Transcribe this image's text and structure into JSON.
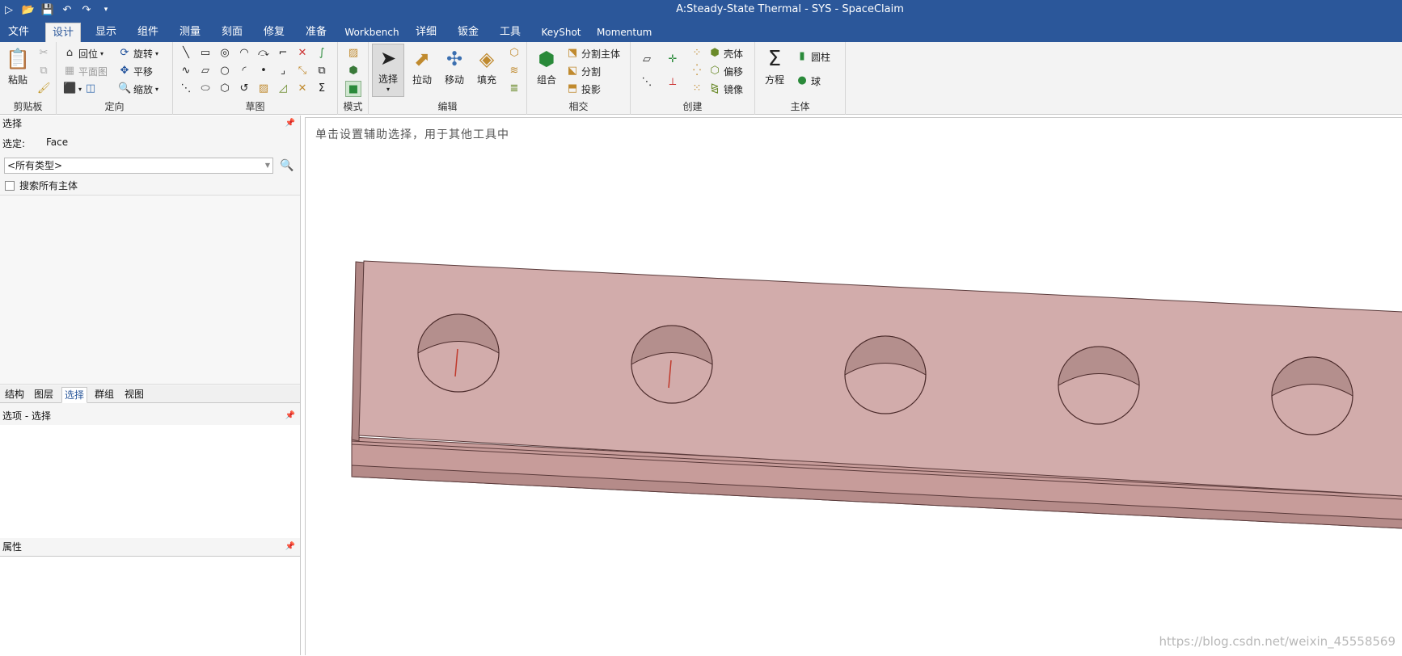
{
  "window": {
    "title": "A:Steady-State Thermal - SYS - SpaceClaim"
  },
  "ribbon_tabs": [
    "文件",
    "设计",
    "显示",
    "组件",
    "测量",
    "刻面",
    "修复",
    "准备",
    "Workbench",
    "详细",
    "钣金",
    "工具",
    "KeyShot",
    "Momentum"
  ],
  "active_tab": "设计",
  "ribbon": {
    "clipboard": {
      "label": "剪贴板",
      "paste": "粘贴"
    },
    "orient": {
      "label": "定向",
      "home": "回位",
      "plan_view": "平面图",
      "rotate": "旋转",
      "pan": "平移",
      "zoom": "缩放"
    },
    "sketch": {
      "label": "草图"
    },
    "mode": {
      "label": "模式"
    },
    "edit": {
      "label": "编辑",
      "select": "选择",
      "pull": "拉动",
      "move": "移动",
      "fill": "填充"
    },
    "intersect": {
      "label": "相交",
      "combine": "组合",
      "split_body": "分割主体",
      "split": "分割",
      "project": "投影"
    },
    "create": {
      "label": "创建",
      "shell": "壳体",
      "offset": "偏移",
      "mirror": "镜像"
    },
    "body": {
      "label": "主体",
      "equation": "方程",
      "cylinder": "圆柱",
      "sphere": "球"
    }
  },
  "selection_panel": {
    "header": "选择",
    "selected_label": "选定:",
    "selected_value": "Face",
    "type_filter": "<所有类型>",
    "search_all_bodies": "搜索所有主体",
    "tabs": [
      "结构",
      "图层",
      "选择",
      "群组",
      "视图"
    ],
    "active_tab": "选择"
  },
  "options_panel": {
    "header": "选项 - 选择"
  },
  "properties_panel": {
    "header": "属性"
  },
  "viewport": {
    "hint": "单击设置辅助选择，用于其他工具中",
    "watermark": "https://blog.csdn.net/weixin_45558569",
    "model_color": "#d2acab"
  }
}
